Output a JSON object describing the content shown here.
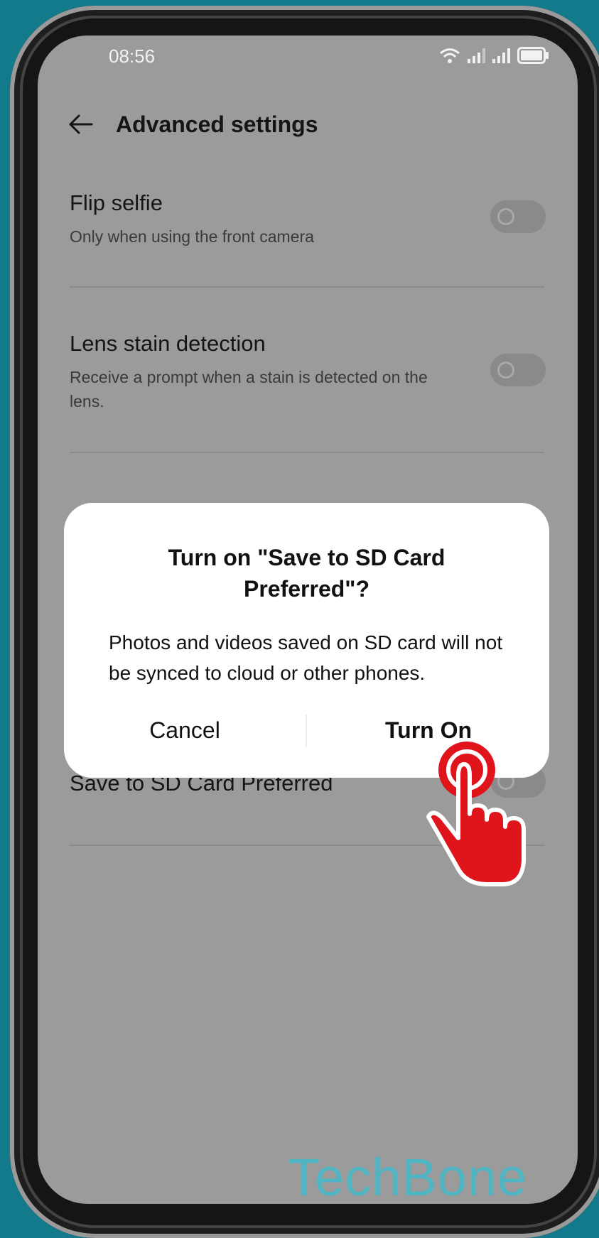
{
  "status_bar": {
    "time": "08:56"
  },
  "header": {
    "title": "Advanced settings"
  },
  "settings": [
    {
      "title": "Flip selfie",
      "desc": "Only when using the front camera"
    },
    {
      "title": "Lens stain detection",
      "desc": "Receive a prompt when a stain is detected on the lens."
    },
    {
      "title": "Save to SD Card Preferred"
    }
  ],
  "dialog": {
    "title": "Turn on \"Save to SD Card Preferred\"?",
    "message": "Photos and videos saved on SD card will not be synced to cloud or other phones.",
    "cancel_label": "Cancel",
    "confirm_label": "Turn On"
  },
  "colors": {
    "background": "#137a8c",
    "overlay": "#9b9b9b",
    "tap_hand": "#e0151b",
    "watermark": "#48b8c8"
  },
  "watermark": "TechBone"
}
